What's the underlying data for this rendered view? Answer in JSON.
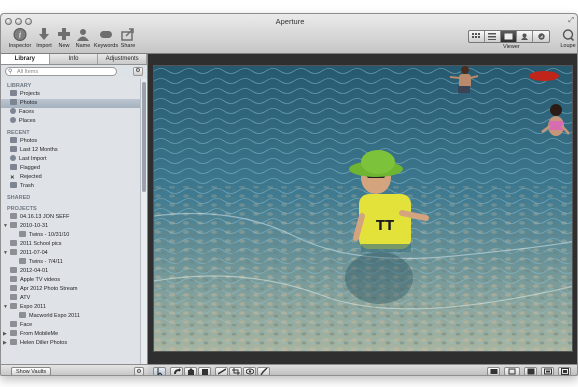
{
  "window": {
    "title": "Aperture"
  },
  "toolbar": {
    "inspector": "Inspector",
    "import": "Import",
    "new": "New",
    "name": "Name",
    "keywords": "Keywords",
    "share": "Share",
    "viewer": "Viewer",
    "loupe": "Loupe"
  },
  "tabs": [
    "Library",
    "Info",
    "Adjustments"
  ],
  "search": {
    "placeholder": "All Items"
  },
  "library": {
    "section": "LIBRARY",
    "items": [
      {
        "label": "Projects",
        "icon": "projects-icon"
      },
      {
        "label": "Photos",
        "icon": "photos-icon",
        "selected": true
      },
      {
        "label": "Faces",
        "icon": "faces-icon"
      },
      {
        "label": "Places",
        "icon": "places-icon"
      }
    ]
  },
  "recent": {
    "section": "RECENT",
    "items": [
      {
        "label": "Photos",
        "icon": "photos-icon"
      },
      {
        "label": "Last 12 Months",
        "icon": "calendar-icon"
      },
      {
        "label": "Last Import",
        "icon": "clock-icon"
      },
      {
        "label": "Flagged",
        "icon": "flag-icon"
      },
      {
        "label": "Rejected",
        "icon": "x-icon"
      },
      {
        "label": "Trash",
        "icon": "trash-icon"
      }
    ]
  },
  "shared": {
    "section": "SHARED"
  },
  "projects": {
    "section": "PROJECTS",
    "items": [
      {
        "label": "04.16.13 JON SEFF",
        "level": 0,
        "disclosure": ""
      },
      {
        "label": "2010-10-31",
        "level": 0,
        "disclosure": "▼"
      },
      {
        "label": "Twins - 10/31/10",
        "level": 1,
        "disclosure": ""
      },
      {
        "label": "2011 School pics",
        "level": 0,
        "disclosure": ""
      },
      {
        "label": "2011-07-04",
        "level": 0,
        "disclosure": "▼"
      },
      {
        "label": "Twins - 7/4/11",
        "level": 1,
        "disclosure": ""
      },
      {
        "label": "2012-04-01",
        "level": 0,
        "disclosure": ""
      },
      {
        "label": "Apple TV videos",
        "level": 0,
        "disclosure": ""
      },
      {
        "label": "Apr 2012 Photo Stream",
        "level": 0,
        "disclosure": ""
      },
      {
        "label": "ATV",
        "level": 0,
        "disclosure": ""
      },
      {
        "label": "Expo 2011",
        "level": 0,
        "disclosure": "▼"
      },
      {
        "label": "Macworld Expo 2011",
        "level": 1,
        "disclosure": ""
      },
      {
        "label": "Face",
        "level": 0,
        "disclosure": ""
      },
      {
        "label": "From MobileMe",
        "level": 0,
        "disclosure": "▶"
      },
      {
        "label": "Helen Diller Photos",
        "level": 0,
        "disclosure": "▶"
      }
    ]
  },
  "footer": {
    "show_vaults": "Show Vaults"
  },
  "colors": {
    "sidebar_bg": "#dfe3e8",
    "selection": "#a5b1bf",
    "viewer_bg": "#2f2f2f",
    "water": "#3f7a91",
    "hat": "#7cc23a",
    "shirt": "#e3e23a"
  }
}
